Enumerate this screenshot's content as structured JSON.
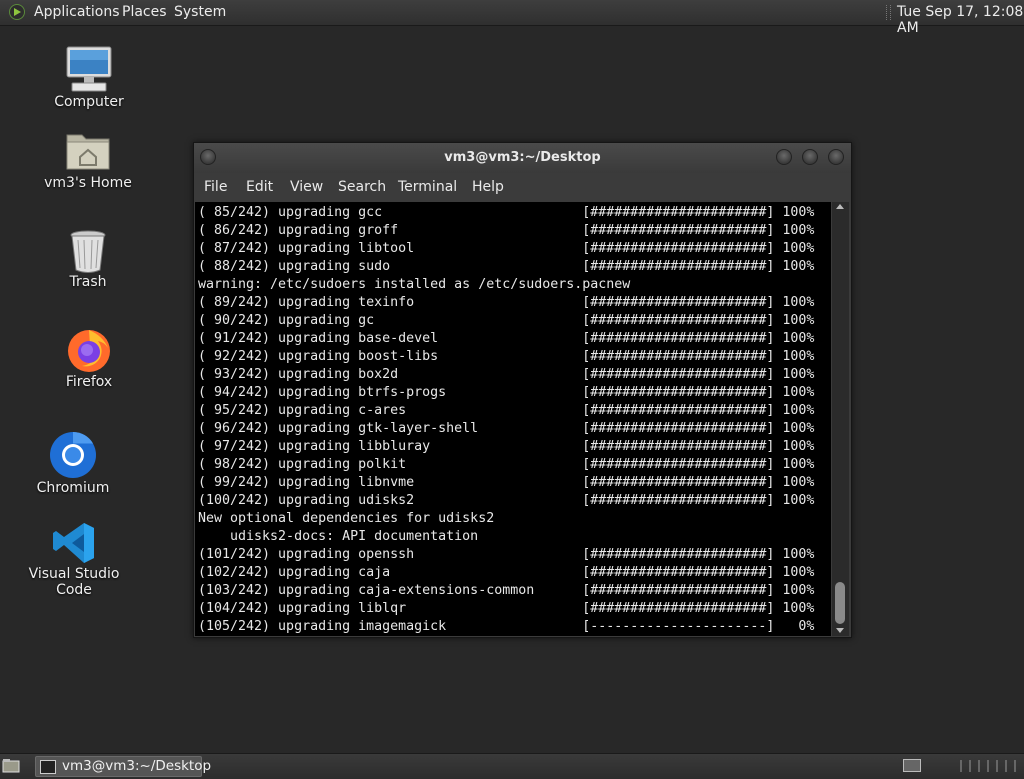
{
  "top_panel": {
    "menu": [
      "Applications",
      "Places",
      "System"
    ],
    "clock": "Tue Sep 17, 12:08 AM"
  },
  "desktop": {
    "icons": [
      {
        "label": "Computer",
        "icon": "computer-icon"
      },
      {
        "label": "vm3's Home",
        "icon": "home-folder-icon"
      },
      {
        "label": "Trash",
        "icon": "trash-icon"
      },
      {
        "label": "Firefox",
        "icon": "firefox-icon"
      },
      {
        "label": "Chromium",
        "icon": "chromium-icon"
      },
      {
        "label": "Visual Studio Code",
        "icon": "vscode-icon"
      }
    ]
  },
  "terminal": {
    "title": "vm3@vm3:~/Desktop",
    "menu": [
      "File",
      "Edit",
      "View",
      "Search",
      "Terminal",
      "Help"
    ],
    "lines": [
      "( 85/242) upgrading gcc                         [######################] 100%",
      "( 86/242) upgrading groff                       [######################] 100%",
      "( 87/242) upgrading libtool                     [######################] 100%",
      "( 88/242) upgrading sudo                        [######################] 100%",
      "warning: /etc/sudoers installed as /etc/sudoers.pacnew",
      "( 89/242) upgrading texinfo                     [######################] 100%",
      "( 90/242) upgrading gc                          [######################] 100%",
      "( 91/242) upgrading base-devel                  [######################] 100%",
      "( 92/242) upgrading boost-libs                  [######################] 100%",
      "( 93/242) upgrading box2d                       [######################] 100%",
      "( 94/242) upgrading btrfs-progs                 [######################] 100%",
      "( 95/242) upgrading c-ares                      [######################] 100%",
      "( 96/242) upgrading gtk-layer-shell             [######################] 100%",
      "( 97/242) upgrading libbluray                   [######################] 100%",
      "( 98/242) upgrading polkit                      [######################] 100%",
      "( 99/242) upgrading libnvme                     [######################] 100%",
      "(100/242) upgrading udisks2                     [######################] 100%",
      "New optional dependencies for udisks2",
      "    udisks2-docs: API documentation",
      "(101/242) upgrading openssh                     [######################] 100%",
      "(102/242) upgrading caja                        [######################] 100%",
      "(103/242) upgrading caja-extensions-common      [######################] 100%",
      "(104/242) upgrading liblqr                      [######################] 100%",
      "(105/242) upgrading imagemagick                 [----------------------]   0%"
    ]
  },
  "bottom_panel": {
    "task_label": "vm3@vm3:~/Desktop"
  }
}
